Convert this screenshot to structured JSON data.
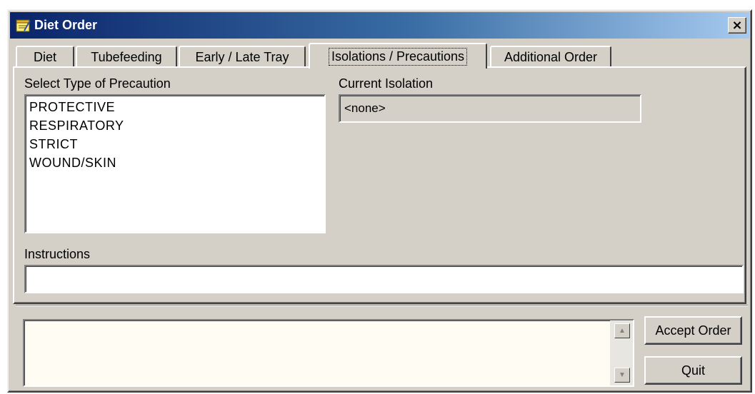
{
  "window": {
    "title": "Diet Order",
    "close_label": "×"
  },
  "tabs": [
    {
      "label": "Diet"
    },
    {
      "label": "Tubefeeding"
    },
    {
      "label": "Early / Late Tray"
    },
    {
      "label": "Isolations / Precautions",
      "active": true
    },
    {
      "label": "Additional Order"
    }
  ],
  "precaution": {
    "label": "Select Type of Precaution",
    "options": [
      "PROTECTIVE",
      "RESPIRATORY",
      "STRICT",
      "WOUND/SKIN"
    ]
  },
  "current_isolation": {
    "label": "Current Isolation",
    "value": "<none>"
  },
  "instructions": {
    "label": "Instructions",
    "value": ""
  },
  "order_memo": {
    "value": ""
  },
  "buttons": {
    "accept": "Accept Order",
    "quit": "Quit"
  },
  "colors": {
    "title_start": "#0a246a",
    "title_end": "#a6caf0",
    "face": "#d4d0c8",
    "memo_bg": "#fffdf3"
  }
}
